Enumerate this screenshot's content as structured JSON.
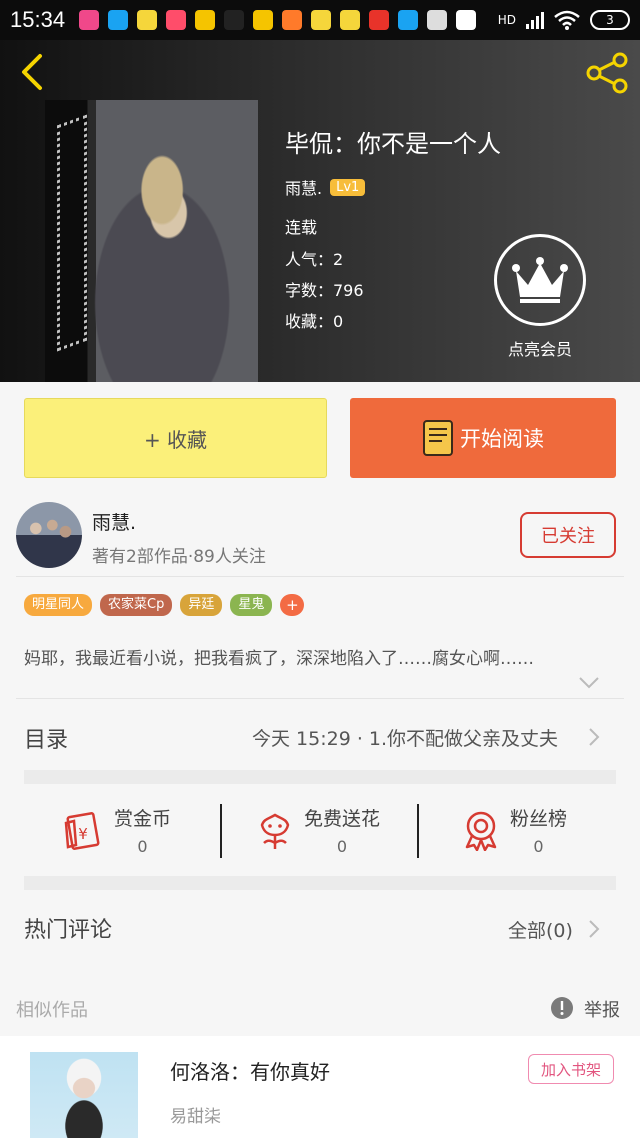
{
  "status_bar": {
    "time": "15:34",
    "network": "HD",
    "battery": "3",
    "notification_icons": [
      {
        "name": "pink-app",
        "color": "#f0488a"
      },
      {
        "name": "blue-app",
        "color": "#1aa3f2"
      },
      {
        "name": "yellow-app",
        "color": "#f5d63b"
      },
      {
        "name": "red-app",
        "color": "#ff4d6a"
      },
      {
        "name": "yellow-app",
        "color": "#f5c400"
      },
      {
        "name": "tiktok-app",
        "color": "#222222"
      },
      {
        "name": "yellow-app",
        "color": "#f5c400"
      },
      {
        "name": "orange-app",
        "color": "#ff7a2a"
      },
      {
        "name": "yellow-app",
        "color": "#f5d63b"
      },
      {
        "name": "yellow-app",
        "color": "#f5d63b"
      },
      {
        "name": "red-app",
        "color": "#e8332a"
      },
      {
        "name": "blue-app",
        "color": "#1aa3f2"
      },
      {
        "name": "music-app",
        "color": "#dddddd"
      },
      {
        "name": "play-store-app",
        "color": "#ffffff"
      }
    ]
  },
  "book": {
    "title": "毕侃：你不是一个人",
    "author": "雨慧.",
    "level": "Lv1",
    "status": "连载",
    "popularity": "人气：2",
    "word_count": "字数：796",
    "favorites": "收藏：0"
  },
  "vip": {
    "label": "点亮会员"
  },
  "actions": {
    "collect": "+ 收藏",
    "read": "开始阅读"
  },
  "author_card": {
    "name": "雨慧.",
    "summary": "著有2部作品·89人关注",
    "follow": "已关注"
  },
  "tags": [
    {
      "label": "明星同人",
      "color": "#f7a93e"
    },
    {
      "label": "农家菜Cp",
      "color": "#c0674c"
    },
    {
      "label": "异廷",
      "color": "#d8a43a"
    },
    {
      "label": "星鬼",
      "color": "#8bb550"
    }
  ],
  "tag_more": "+",
  "description": "妈耶，我最近看小说，把我看疯了，深深地陷入了……腐女心啊……",
  "toc": {
    "label": "目录",
    "latest": "今天 15:29 · 1.你不配做父亲及丈夫"
  },
  "rewards": [
    {
      "label": "赏金币",
      "value": "0"
    },
    {
      "label": "免费送花",
      "value": "0"
    },
    {
      "label": "粉丝榜",
      "value": "0"
    }
  ],
  "comments": {
    "label": "热门评论",
    "all": "全部(0)"
  },
  "similar": {
    "label": "相似作品",
    "report": "举报",
    "item": {
      "title": "何洛洛：有你真好",
      "author": "易甜柒",
      "add": "加入书架"
    }
  },
  "colors": {
    "accent_red": "#d63b32",
    "read_button": "#ef6a3c",
    "collect_button": "#fbf07a",
    "back_arrow": "#f5d400"
  }
}
